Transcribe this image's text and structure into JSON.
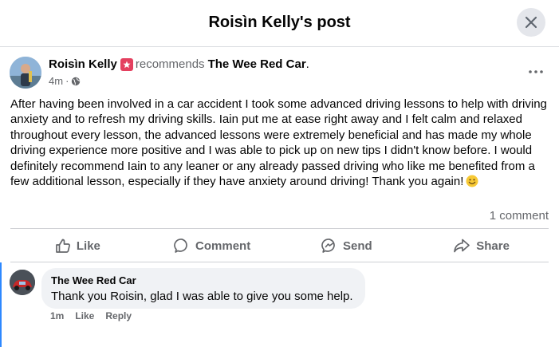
{
  "header": {
    "title": "Roisìn Kelly's post"
  },
  "post": {
    "author": "Roisìn Kelly",
    "action": "recommends",
    "page": "The Wee Red Car",
    "period": ".",
    "time": "4m",
    "separator": "·",
    "body": "After having been involved in a car accident I took some advanced driving lessons to help with driving anxiety and to refresh my driving skills. Iain put me at ease right away and I felt calm and relaxed throughout every lesson, the advanced lessons were extremely beneficial and has made my whole driving experience more positive and I was able to pick up on new tips I didn't know before. I would definitely recommend Iain to any leaner or any already passed driving who like me benefited from a few additional lesson, especially if they have anxiety around driving! Thank you again!",
    "comment_count": "1 comment"
  },
  "actions": {
    "like": "Like",
    "comment": "Comment",
    "send": "Send",
    "share": "Share"
  },
  "comment": {
    "author": "The Wee Red Car",
    "text": "Thank you Roisin, glad I was able to give you some help.",
    "time": "1m",
    "like": "Like",
    "reply": "Reply"
  },
  "colors": {
    "accent": "#2d88ff",
    "badge": "#e4405f",
    "secondary_text": "#65676b",
    "bubble": "#f0f2f5"
  },
  "icons": [
    "close-icon",
    "more-icon",
    "globe-icon",
    "star-badge-icon",
    "smile-emoji-icon",
    "like-icon",
    "comment-icon",
    "send-icon",
    "share-icon"
  ]
}
